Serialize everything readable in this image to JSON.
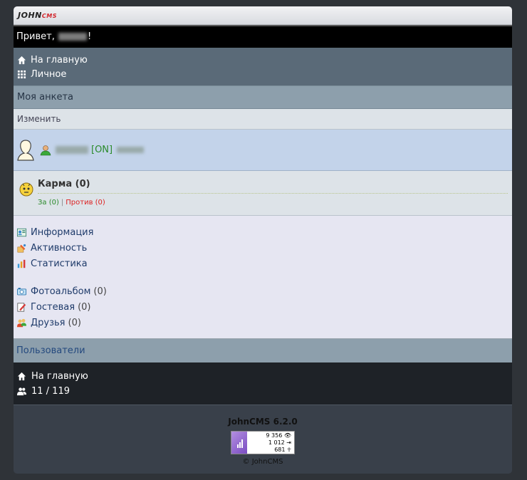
{
  "logo": {
    "main": "JOHN",
    "accent": "CMS"
  },
  "greeting": {
    "prefix": "Привет,",
    "suffix": "!"
  },
  "nav_top": [
    {
      "icon": "home-icon",
      "label": "На главную"
    },
    {
      "icon": "grid-icon",
      "label": "Личное"
    }
  ],
  "profile_header": "Моя анкета",
  "edit_label": "Изменить",
  "user": {
    "status": "[ON]"
  },
  "karma": {
    "title": "Карма (0)",
    "yes": "За (0)",
    "separator": "|",
    "no": "Против (0)"
  },
  "menu_group1": [
    {
      "icon": "info-card-icon",
      "label": "Информация"
    },
    {
      "icon": "activity-icon",
      "label": "Активность"
    },
    {
      "icon": "stats-icon",
      "label": "Статистика"
    }
  ],
  "menu_group2": [
    {
      "icon": "photo-album-icon",
      "label": "Фотоальбом",
      "count": "(0)"
    },
    {
      "icon": "guestbook-icon",
      "label": "Гостевая",
      "count": "(0)"
    },
    {
      "icon": "friends-icon",
      "label": "Друзья",
      "count": "(0)"
    }
  ],
  "users_link": "Пользователи",
  "nav_bottom": {
    "home": "На главную",
    "online": "11 / 119"
  },
  "footer": {
    "version": "JohnCMS 6.2.0",
    "counter": [
      "9 356",
      "1 012",
      "681"
    ],
    "copyright": "© JohnCMS"
  },
  "colors": {
    "online": "#2a8a2a",
    "against": "#dd2222",
    "link": "#1f3b6a"
  }
}
